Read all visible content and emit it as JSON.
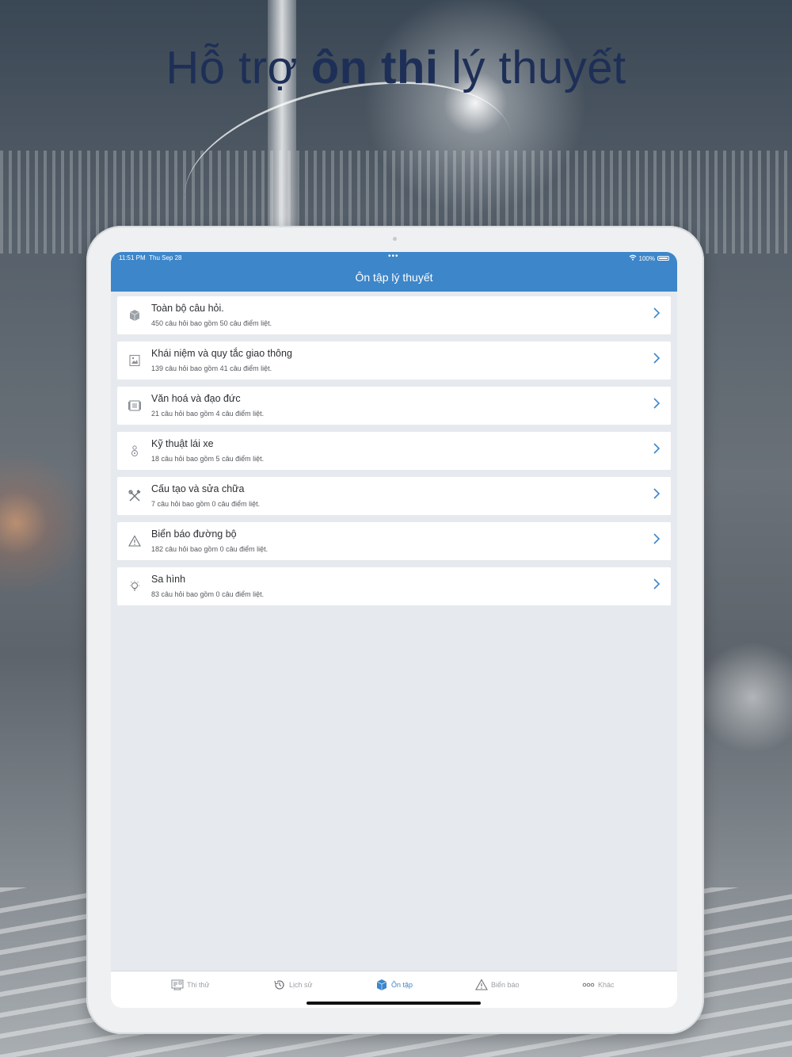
{
  "headline": {
    "part1": "Hỗ trợ ",
    "bold": "ôn thi",
    "part2": " lý thuyết"
  },
  "status_bar": {
    "time": "11:51 PM",
    "date": "Thu Sep 28",
    "dots": "•••",
    "battery": "100%"
  },
  "nav": {
    "title": "Ôn tập lý thuyết"
  },
  "items": [
    {
      "title": "Toàn bộ câu hỏi.",
      "subtitle": "450 câu hỏi bao gồm 50 câu điểm liệt.",
      "icon": "cube-icon"
    },
    {
      "title": "Khái niệm và quy tắc giao thông",
      "subtitle": "139 câu hỏi bao gồm 41 câu điểm liệt.",
      "icon": "image-frame-icon"
    },
    {
      "title": "Văn hoá và đạo đức",
      "subtitle": "21 câu hỏi bao gồm 4 câu điểm liệt.",
      "icon": "scroll-icon"
    },
    {
      "title": "Kỹ thuật lái xe",
      "subtitle": "18 câu hỏi bao gồm 5 câu điểm liệt.",
      "icon": "driver-icon"
    },
    {
      "title": "Cấu tạo và sửa chữa",
      "subtitle": "7 câu hỏi bao gồm 0 câu điểm liệt.",
      "icon": "tools-icon"
    },
    {
      "title": "Biển báo đường bộ",
      "subtitle": "182 câu hỏi bao gồm 0 câu điểm liệt.",
      "icon": "warning-icon"
    },
    {
      "title": "Sa hình",
      "subtitle": "83 câu hỏi bao gồm 0 câu điểm liệt.",
      "icon": "lightbulb-icon"
    }
  ],
  "tabs": [
    {
      "label": "Thi thử",
      "icon": "exam-icon",
      "active": false
    },
    {
      "label": "Lịch sử",
      "icon": "history-icon",
      "active": false
    },
    {
      "label": "Ôn tập",
      "icon": "cube-icon",
      "active": true
    },
    {
      "label": "Biển báo",
      "icon": "warning-icon",
      "active": false
    },
    {
      "label": "Khác",
      "icon": "more-icon",
      "active": false
    }
  ],
  "colors": {
    "accent": "#3d86c9",
    "headline": "#1e2f57"
  }
}
